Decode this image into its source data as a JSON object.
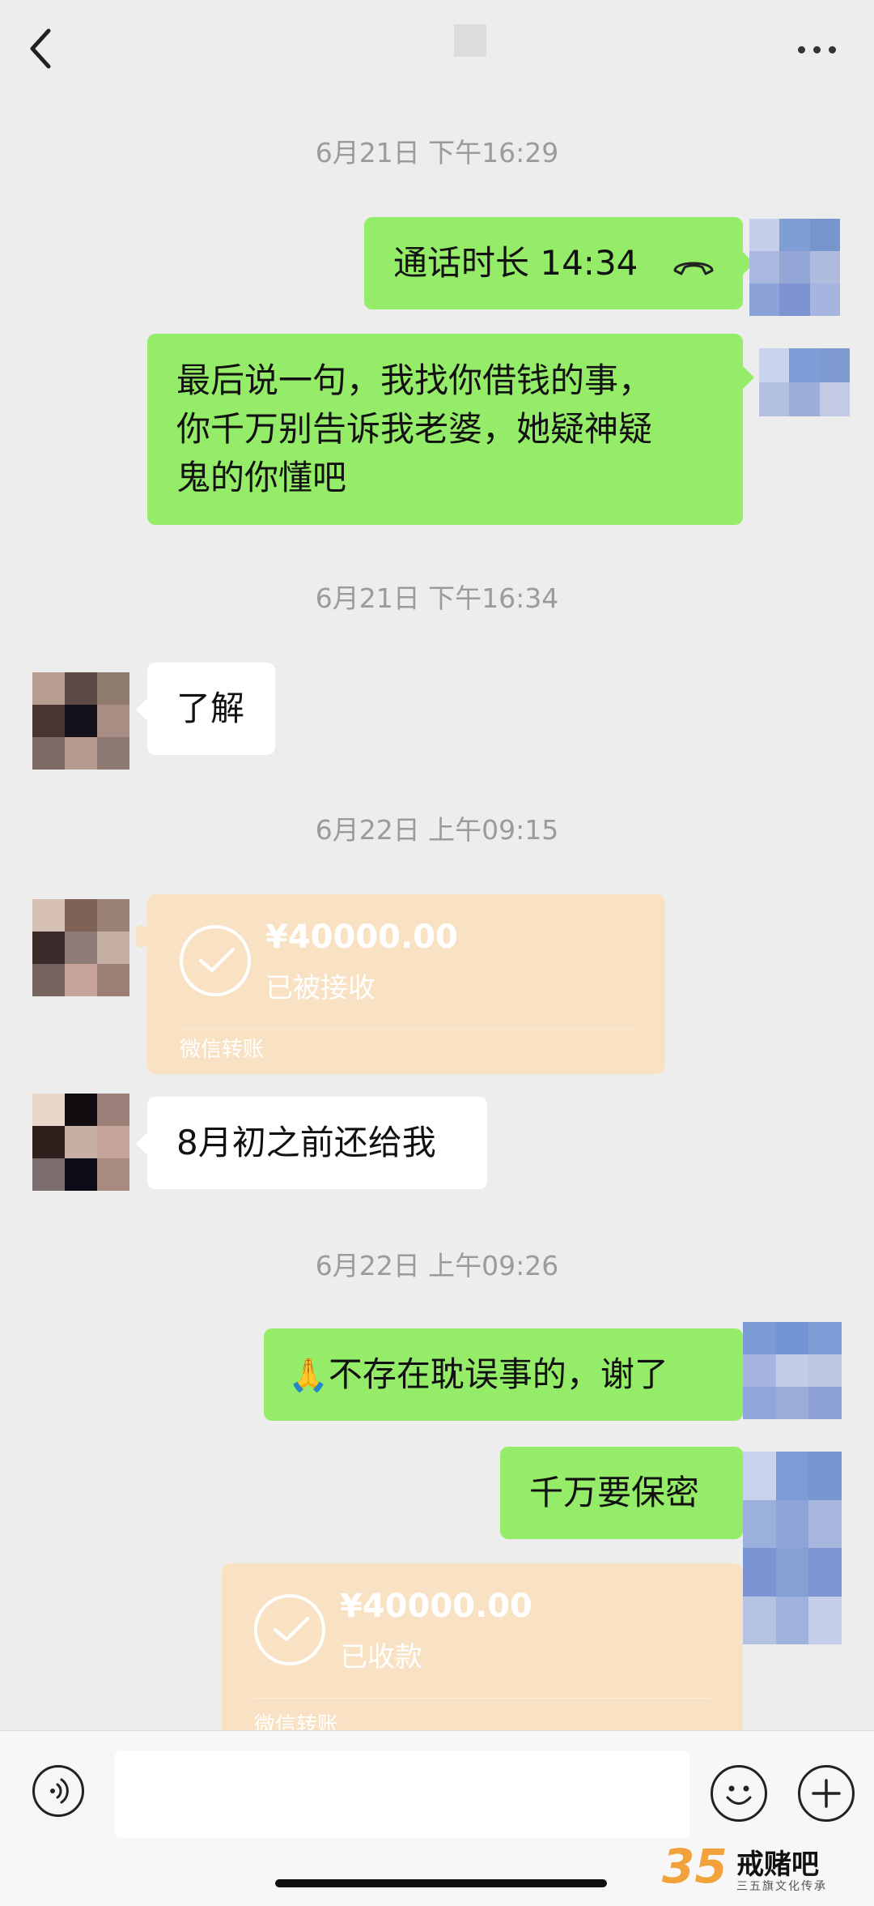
{
  "header": {
    "title": "",
    "back_icon": "chevron-left-icon",
    "more_icon": "more-dots-icon"
  },
  "messages": {
    "ts1": "6月21日 下午16:29",
    "call_label": "通话时长 14:34",
    "call_icon": "phone-hangup-icon",
    "msg1_line1": "最后说一句，我找你借钱的事，",
    "msg1_line2": "你千万别告诉我老婆，她疑神疑",
    "msg1_line3": "鬼的你懂吧",
    "ts2": "6月21日 下午16:34",
    "reply1": "了解",
    "ts3": "6月22日 上午09:15",
    "transfer1": {
      "amount": "¥40000.00",
      "status": "已被接收",
      "footer": "微信转账"
    },
    "reply2": "8月初之前还给我",
    "ts4": "6月22日 上午09:26",
    "msg2_emoji": "🙏",
    "msg2": "不存在耽误事的，谢了",
    "msg3": "千万要保密",
    "transfer2": {
      "amount": "¥40000.00",
      "status": "已收款",
      "footer": "微信转账"
    }
  },
  "input_bar": {
    "voice_icon": "voice-icon",
    "emoji_icon": "emoji-icon",
    "plus_icon": "plus-icon"
  },
  "watermark": {
    "number": "35",
    "name": "戒赌吧",
    "tagline": "三五旗文化传承"
  },
  "colors": {
    "background": "#EDEDED",
    "bubble_out": "#95EC69",
    "bubble_in": "#FFFFFF",
    "transfer": "#F9E2C4"
  }
}
